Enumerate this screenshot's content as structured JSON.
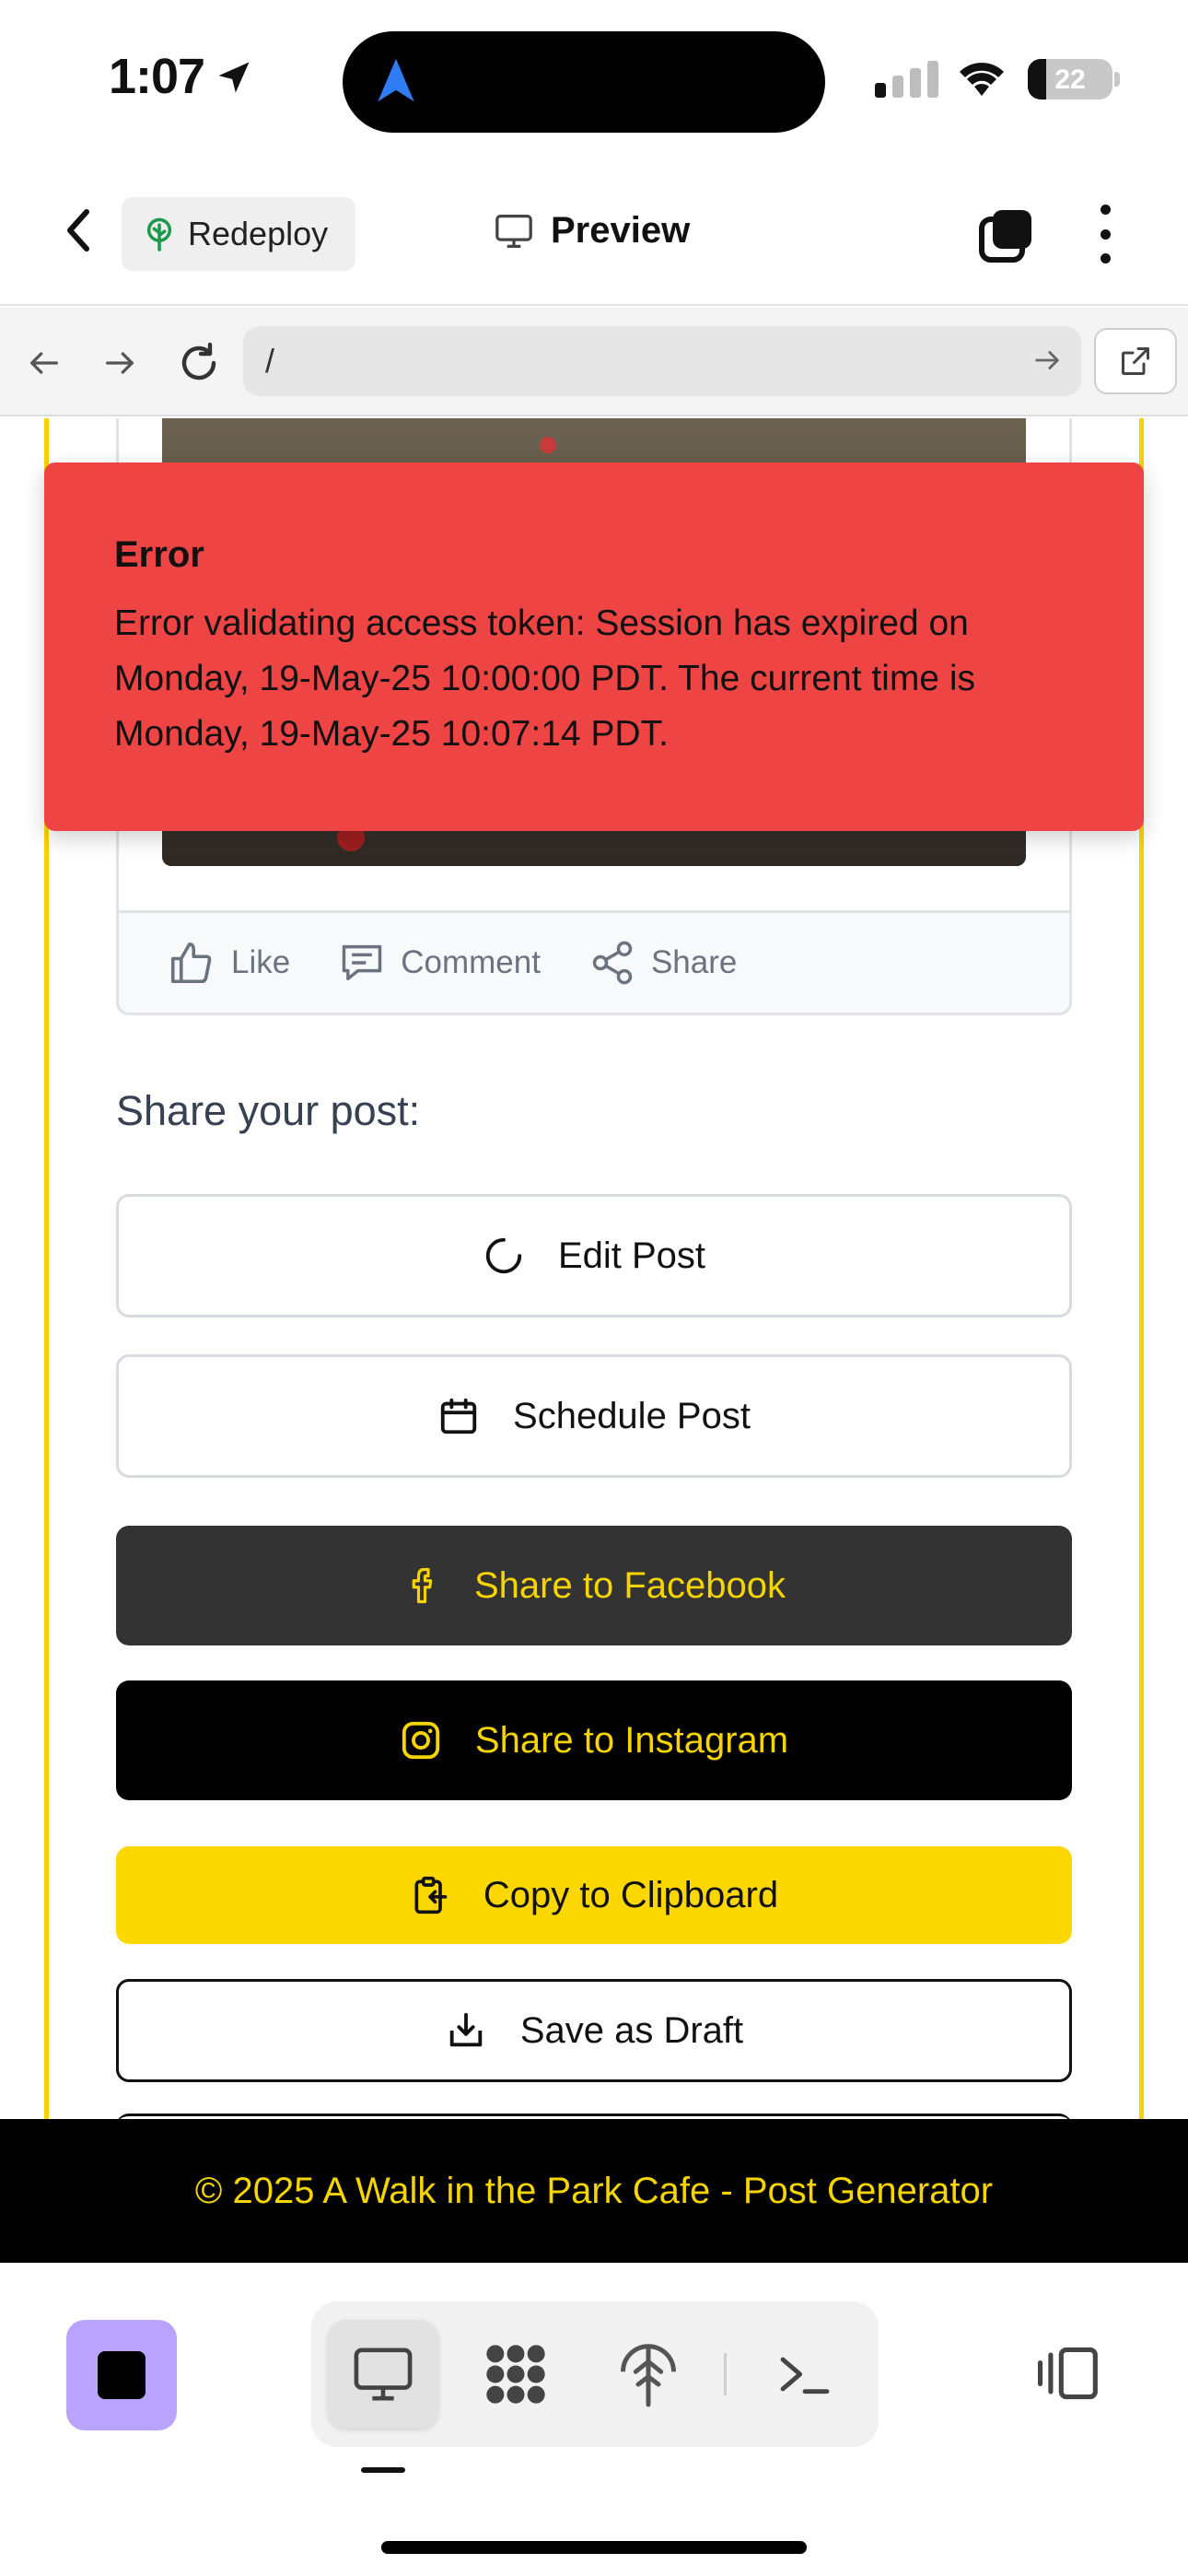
{
  "status_bar": {
    "time": "1:07",
    "battery": "22"
  },
  "app_header": {
    "redeploy_label": "Redeploy",
    "preview_label": "Preview"
  },
  "browser": {
    "url": "/"
  },
  "post_actions": {
    "like": "Like",
    "comment": "Comment",
    "share": "Share"
  },
  "share_section": {
    "heading": "Share your post:",
    "edit_post": "Edit Post",
    "schedule_post": "Schedule Post",
    "share_facebook": "Share to Facebook",
    "share_instagram": "Share to Instagram",
    "copy_clipboard": "Copy to Clipboard",
    "save_draft": "Save as Draft"
  },
  "error_toast": {
    "title": "Error",
    "message": "Error validating access token: Session has expired on Monday, 19-May-25 10:00:00 PDT. The current time is Monday, 19-May-25 10:07:14 PDT."
  },
  "footer": {
    "text": "© 2025 A Walk in the Park Cafe - Post Generator"
  },
  "colors": {
    "accent_yellow": "#fdd800",
    "error_red": "#ef4444",
    "stop_purple": "#b9a3ff",
    "facebook_button": "#333333"
  },
  "icons": {
    "back": "chevron-left-icon",
    "redeploy": "tree-icon",
    "preview": "monitor-icon",
    "tabs": "tabs-icon",
    "more": "more-vertical-icon",
    "edit": "loader-icon",
    "schedule": "calendar-icon",
    "facebook": "facebook-icon",
    "instagram": "instagram-icon",
    "clipboard": "clipboard-icon",
    "draft": "download-icon"
  }
}
